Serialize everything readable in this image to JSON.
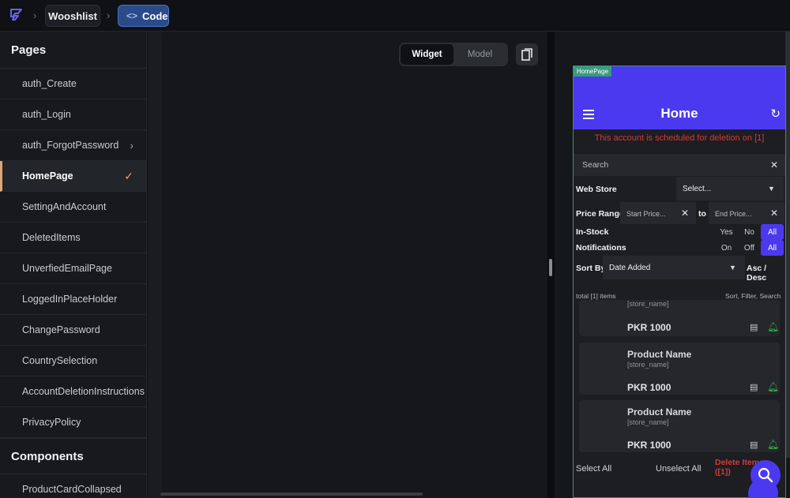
{
  "breadcrumb": {
    "project": "Wooshlist",
    "mode": "Code"
  },
  "sidebar": {
    "pages_title": "Pages",
    "items": [
      {
        "label": "auth_Create"
      },
      {
        "label": "auth_Login"
      },
      {
        "label": "auth_ForgotPassword"
      },
      {
        "label": "HomePage"
      },
      {
        "label": "SettingAndAccount"
      },
      {
        "label": "DeletedItems"
      },
      {
        "label": "UnverfiedEmailPage"
      },
      {
        "label": "LoggedInPlaceHolder"
      },
      {
        "label": "ChangePassword"
      },
      {
        "label": "CountrySelection"
      },
      {
        "label": "AccountDeletionInstructions"
      },
      {
        "label": "PrivacyPolicy"
      }
    ],
    "components_title": "Components",
    "components": [
      {
        "label": "ProductCardCollapsed"
      }
    ]
  },
  "editor": {
    "widget_tab": "Widget",
    "model_tab": "Model"
  },
  "preview": {
    "tag": "HomePage",
    "title": "Home",
    "warning": "This account is scheduled for deletion on [1]",
    "search_placeholder": "Search",
    "web_store_label": "Web Store",
    "web_store_value": "Select...",
    "price_range_label": "Price Range",
    "start_price": "Start Price...",
    "to": "to",
    "end_price": "End Price...",
    "in_stock_label": "In-Stock",
    "in_stock_options": [
      "Yes",
      "No",
      "All"
    ],
    "notifications_label": "Notifications",
    "notifications_options": [
      "On",
      "Off",
      "All"
    ],
    "sort_label": "Sort By",
    "sort_value": "Date Added",
    "sort_order": "Asc / Desc",
    "total": "total [1] items",
    "hint": "Sort, Filter, Search",
    "cards": [
      {
        "name": "",
        "store": "[store_name]",
        "price": "PKR 1000"
      },
      {
        "name": "Product Name",
        "store": "[store_name]",
        "price": "PKR 1000"
      },
      {
        "name": "Product Name",
        "store": "[store_name]",
        "price": "PKR 1000"
      }
    ],
    "select_all": "Select All",
    "unselect_all": "Unselect All",
    "delete_items_line1": "Delete Items",
    "delete_items_line2": "([1])"
  },
  "colors": {
    "accent": "#4b39ef",
    "warning": "#d23a3a",
    "active_marker": "#e0a37a"
  }
}
